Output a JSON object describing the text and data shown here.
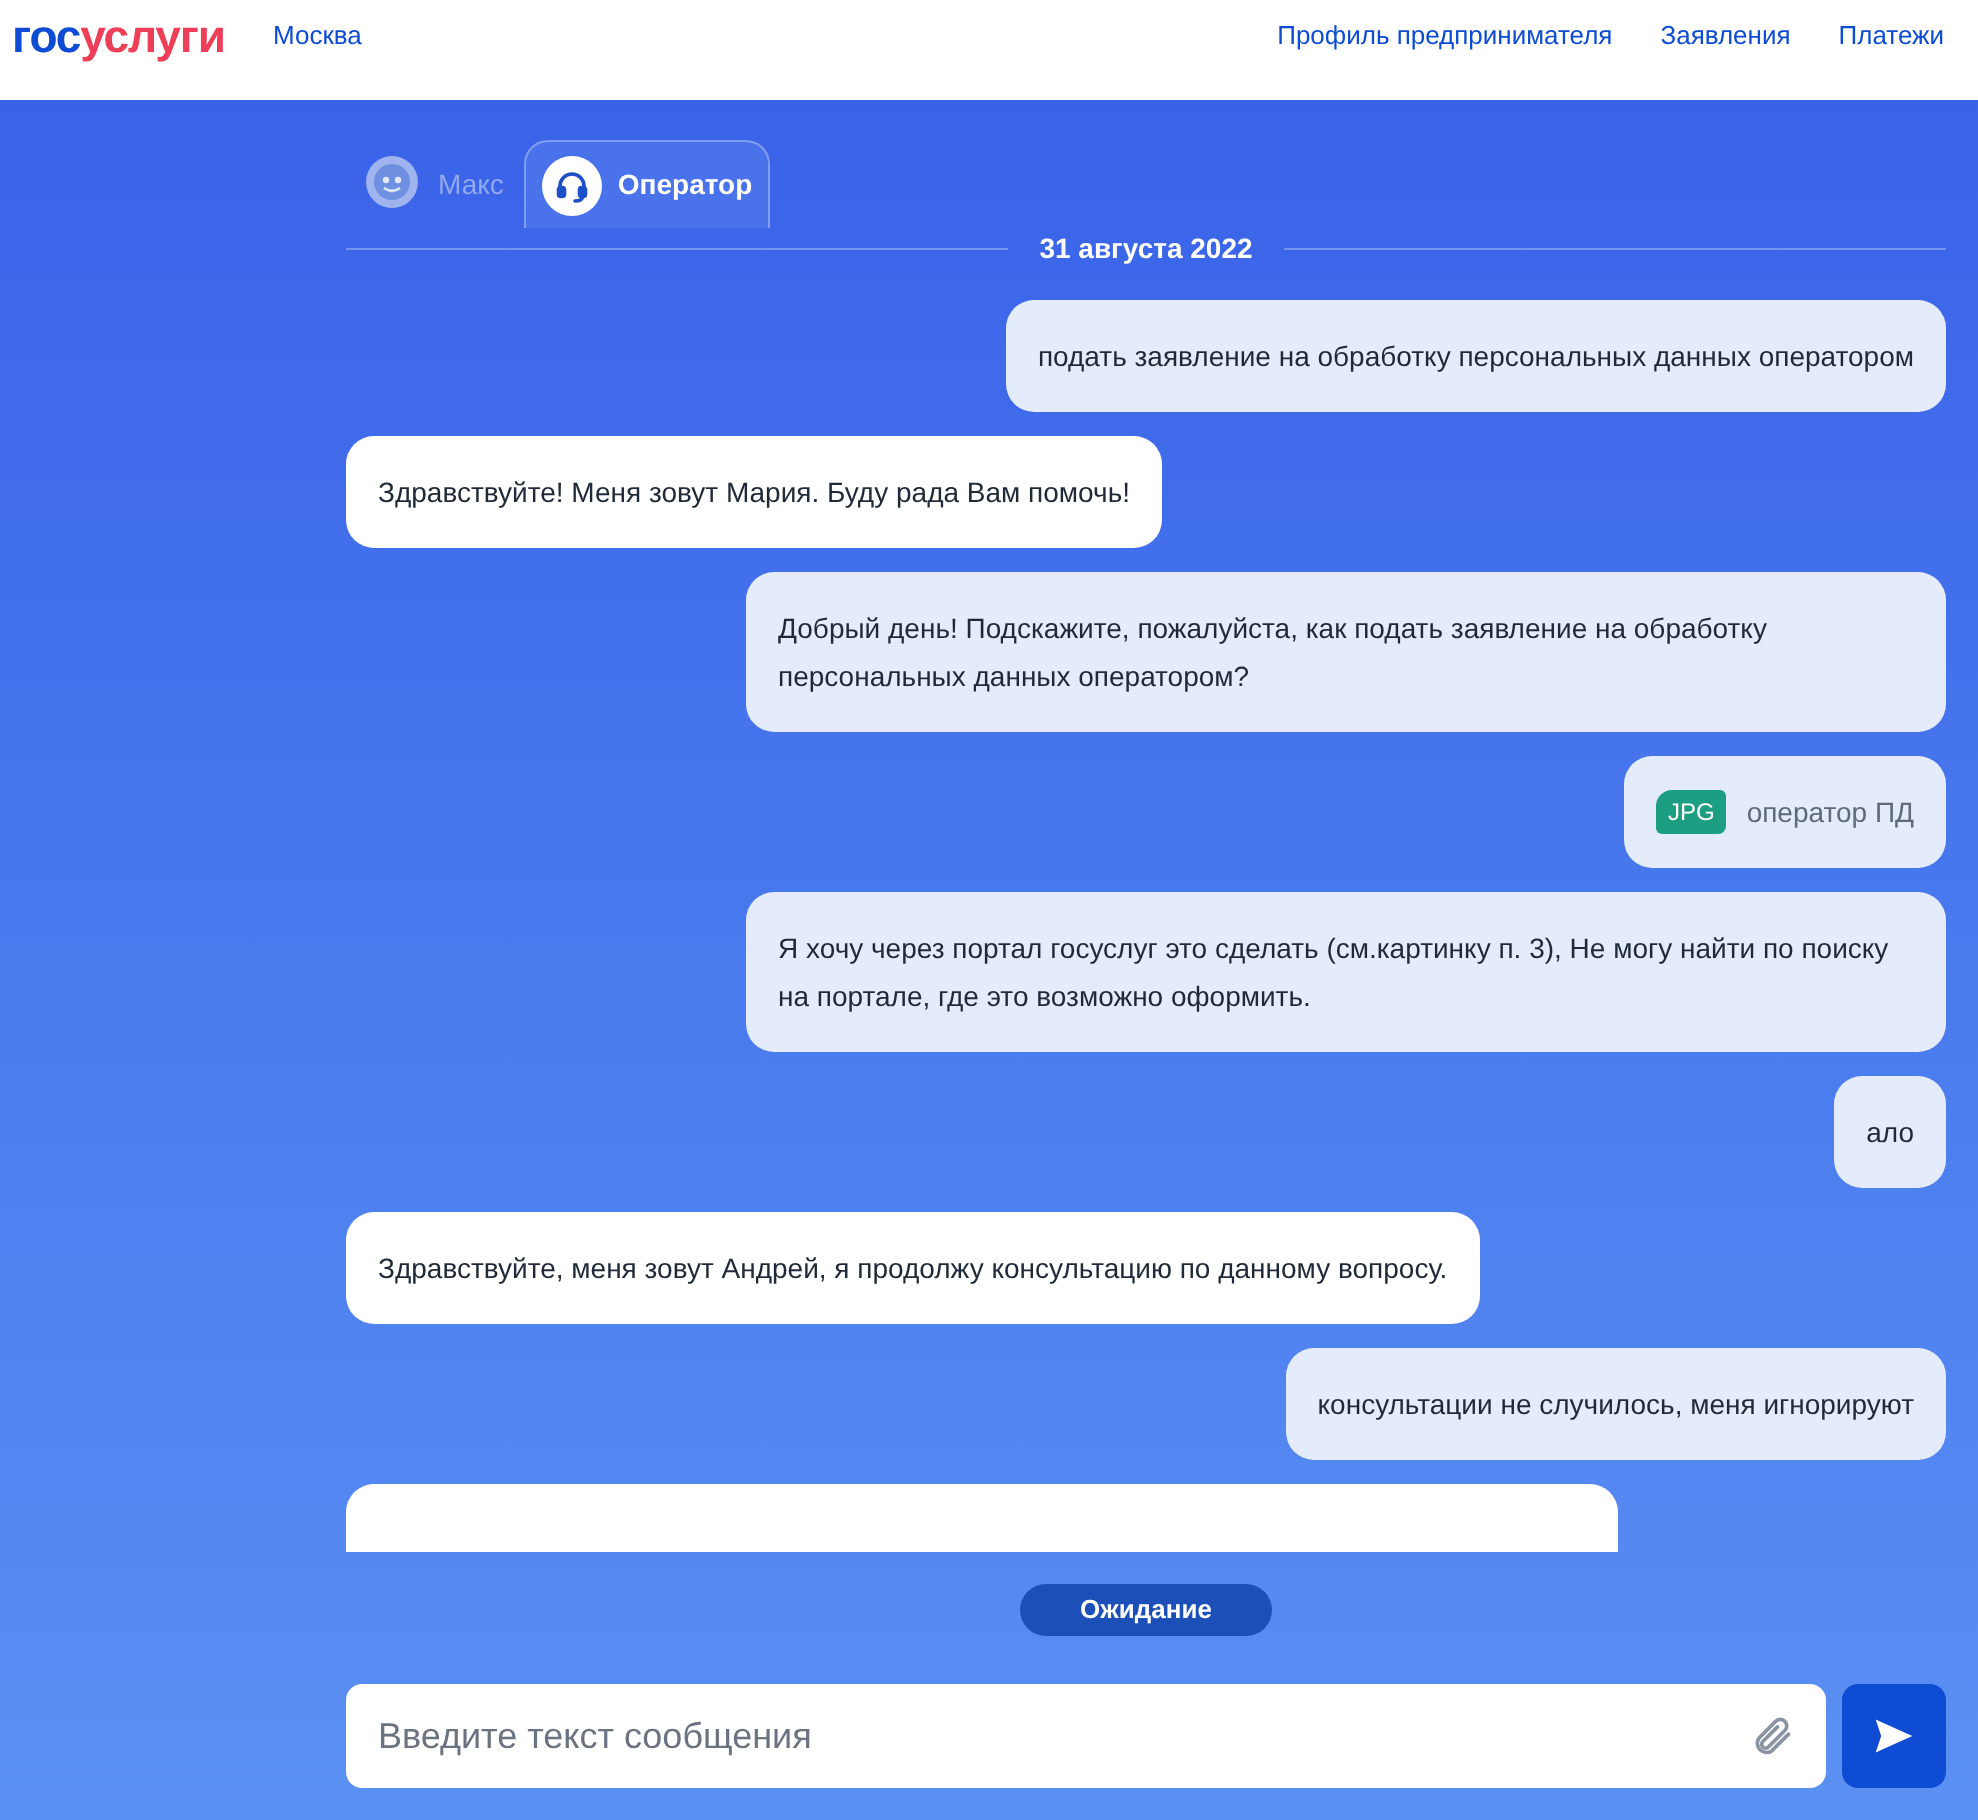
{
  "header": {
    "logo": {
      "part_1": "гос",
      "part_2": "услуги"
    },
    "city": "Москва",
    "nav": [
      "Профиль предпринимателя",
      "Заявления",
      "Платежи"
    ]
  },
  "tabs": [
    {
      "label": "Макс",
      "selected": false,
      "kind": "bot"
    },
    {
      "label": "Оператор",
      "selected": true,
      "kind": "operator"
    }
  ],
  "date": "31 августа 2022",
  "messages": [
    {
      "kind": "outgoing",
      "text": "подать заявление на обработку персональных данных оператором"
    },
    {
      "kind": "incoming",
      "text": "Здравствуйте! Меня зовут Мария. Буду рада Вам помочь!"
    },
    {
      "kind": "outgoing",
      "text": "Добрый день! Подскажите, пожалуйста, как подать заявление на обработку персональных данных оператором?"
    },
    {
      "kind": "file",
      "file_type": "JPG",
      "text": "оператор ПД"
    },
    {
      "kind": "outgoing",
      "text": "Я хочу через портал госуслуг это сделать (см.картинку п. 3), Не могу найти по поиску на портале, где это возможно оформить."
    },
    {
      "kind": "outgoing",
      "text": "ало"
    },
    {
      "kind": "incoming",
      "text": "Здравствуйте, меня зовут Андрей, я продолжу консультацию по данному вопросу."
    },
    {
      "kind": "outgoing",
      "text": "консультации не случилось, меня игнорируют"
    },
    {
      "kind": "cut"
    }
  ],
  "status": "Ожидание",
  "input": {
    "placeholder": "Введите текст сообщения"
  }
}
